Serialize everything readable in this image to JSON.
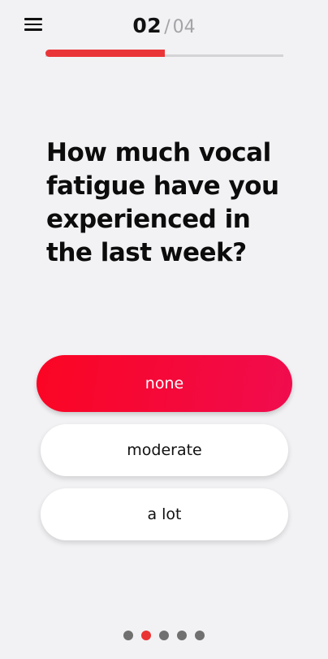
{
  "header": {
    "menu_icon": "hamburger-menu-icon",
    "step_current": "02",
    "step_separator": "/",
    "step_total": "04",
    "progress_fraction": 0.5
  },
  "question": {
    "text": "How much vocal fatigue have you experienced in the last week?"
  },
  "options": [
    {
      "label": "none",
      "selected": true
    },
    {
      "label": "moderate",
      "selected": false
    },
    {
      "label": "a lot",
      "selected": false
    }
  ],
  "pagination": {
    "count": 5,
    "active_index": 1
  },
  "colors": {
    "accent": "#ea3538",
    "selected_gradient_start": "#fb0523",
    "selected_gradient_end": "#f00c4e",
    "background": "#f2f2f4"
  }
}
